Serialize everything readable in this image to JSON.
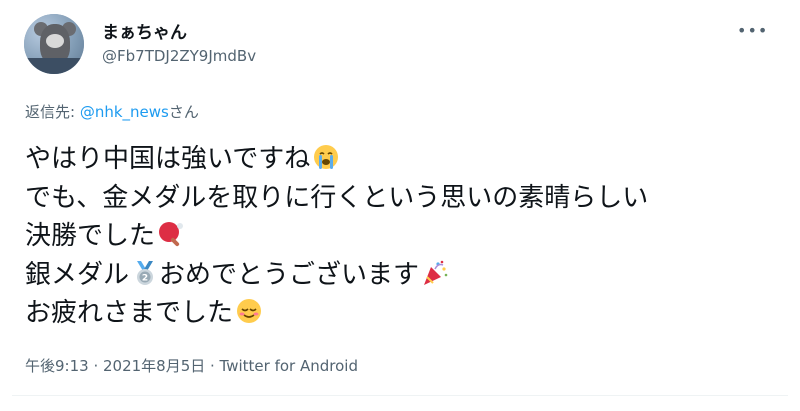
{
  "user": {
    "display_name": "まぁちゃん",
    "handle": "@Fb7TDJ2ZY9JmdBv"
  },
  "reply": {
    "prefix": "返信先: ",
    "mention": "@nhk_news",
    "suffix": "さん"
  },
  "tweet": {
    "lines": [
      "やはり中国は強いですね",
      "でも、金メダルを取りに行くという思いの素晴らしい",
      "決勝でした",
      "銀メダル",
      "おめでとうございます",
      "お疲れさまでした"
    ],
    "emojis": [
      "loudly-crying-face",
      "ping-pong-paddle",
      "silver-medal",
      "party-popper",
      "relieved-face"
    ]
  },
  "meta": {
    "timestamp": "午後9:13 · 2021年8月5日 · Twitter for Android"
  },
  "more_label": "•••",
  "colors": {
    "text": "#0f1419",
    "secondary": "#536471",
    "link": "#1d9bf0"
  }
}
